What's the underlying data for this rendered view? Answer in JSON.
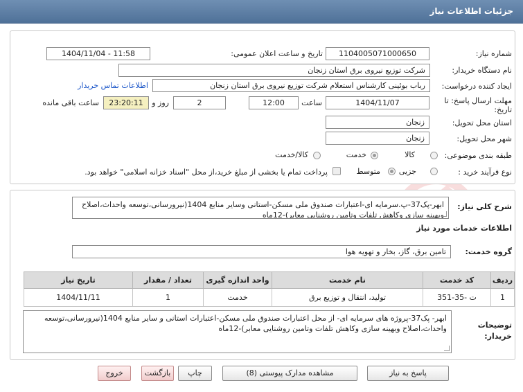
{
  "header": {
    "title": "جزئیات اطلاعات نیاز"
  },
  "form": {
    "need_number_label": "شماره نیاز:",
    "need_number": "1104005071000650",
    "announce_label": "تاریخ و ساعت اعلان عمومی:",
    "announce_value": "1404/11/04 - 11:58",
    "buyer_org_label": "نام دستگاه خریدار:",
    "buyer_org": "شرکت توزیع نیروی برق استان زنجان",
    "creator_label": "ایجاد کننده درخواست:",
    "creator": "رباب بوئینی کارشناس استعلام شرکت توزیع نیروی برق استان زنجان",
    "contact_link": "اطلاعات تماس خریدار",
    "deadline_label": "مهلت ارسال پاسخ: تا تاریخ:",
    "deadline_date": "1404/11/07",
    "time_label": "ساعت",
    "deadline_time": "12:00",
    "days_value": "2",
    "days_label": "روز و",
    "remaining_time": "23:20:11",
    "remaining_label": "ساعت باقی مانده",
    "province_label": "استان محل تحویل:",
    "province": "زنجان",
    "city_label": "شهر محل تحویل:",
    "city": "زنجان",
    "category_label": "طبقه بندی موضوعی:",
    "category_options": [
      "کالا",
      "خدمت",
      "کالا/خدمت"
    ],
    "process_label": "نوع فرآیند خرید :",
    "process_options": [
      "جزیی",
      "متوسط"
    ],
    "payment_note": "پرداخت تمام یا بخشی از مبلغ خرید،از محل \"اسناد خزانه اسلامی\" خواهد بود."
  },
  "description": {
    "label": "شرح کلی نیاز:",
    "text": "ابهر-پک37-پ.سرمایه ای-اعتبارات صندوق ملی مسکن-استانی وسایر منابع 1404(نیرورسانی،توسعه واحداث،اصلاح وبهینه سازی وکاهش تلفات وتامین روشنایی معابر)-12ماه"
  },
  "services": {
    "section_title": "اطلاعات خدمات مورد نیاز",
    "group_label": "گروه خدمت:",
    "group_value": "تامین برق، گاز، بخار و تهویه هوا",
    "columns": [
      "ردیف",
      "کد خدمت",
      "نام خدمت",
      "واحد اندازه گیری",
      "تعداد / مقدار",
      "تاریخ نیاز"
    ],
    "rows": [
      [
        "1",
        "ت -35-351",
        "تولید، انتقال و توزیع برق",
        "خدمت",
        "1",
        "1404/11/11"
      ]
    ]
  },
  "buyer_notes": {
    "label": "توضیحات خریدار:",
    "text": "ابهر-  پک37-پروژه های سرمایه ای- از محل اعتبارات صندوق ملی مسکن-اعتبارات استانی و سایر منابع 1404(نیرورسانی،توسعه واحداث،اصلاح وبهینه سازی وکاهش تلفات وتامین روشنایی معابر)-12ماه"
  },
  "buttons": {
    "respond": "پاسخ به نیاز",
    "attachments": "مشاهده مدارک پیوستی (8)",
    "print": "چاپ",
    "back": "بازگشت",
    "exit": "خروج"
  },
  "watermark_text": "AriaTender.net"
}
